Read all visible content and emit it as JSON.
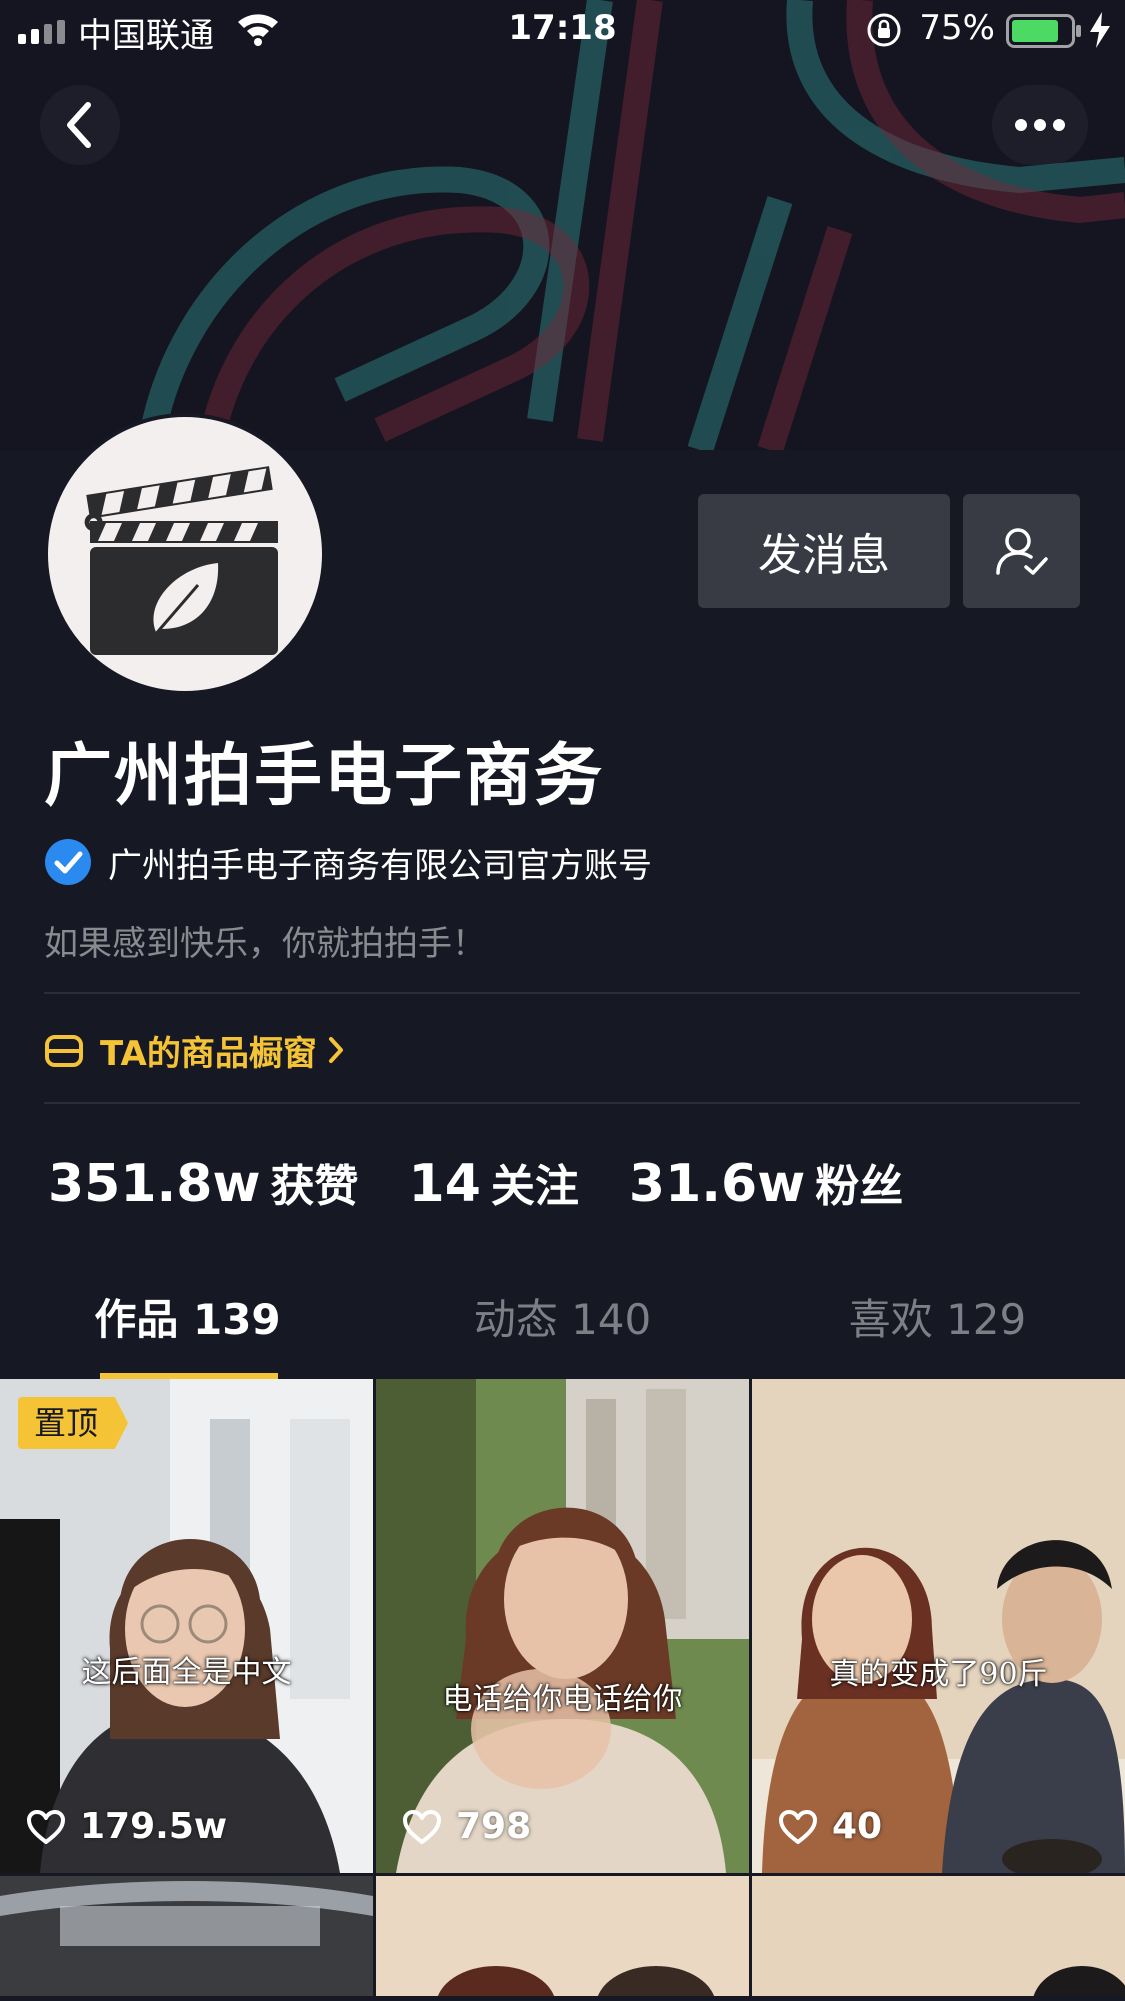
{
  "status_bar": {
    "carrier": "中国联通",
    "time": "17:18",
    "battery_percent": "75%"
  },
  "header": {
    "back_icon": "chevron-left-icon",
    "more_icon": "more-horizontal-icon"
  },
  "profile": {
    "name": "广州拍手电子商务",
    "verified_text": "广州拍手电子商务有限公司官方账号",
    "bio": "如果感到快乐，你就拍拍手！",
    "message_button": "发消息",
    "shop_label": "TA的商品橱窗",
    "stats": [
      {
        "value": "351.8w",
        "label": "获赞"
      },
      {
        "value": "14",
        "label": "关注"
      },
      {
        "value": "31.6w",
        "label": "粉丝"
      }
    ]
  },
  "tabs": [
    {
      "label": "作品 139",
      "active": true
    },
    {
      "label": "动态 140",
      "active": false
    },
    {
      "label": "喜欢 129",
      "active": false
    }
  ],
  "videos": [
    {
      "pinned_label": "置顶",
      "caption": "这后面全是中文",
      "likes": "179.5w"
    },
    {
      "caption": "电话给你电话给你",
      "likes": "798"
    },
    {
      "caption": "真的变成了90斤",
      "likes": "40"
    }
  ],
  "colors": {
    "background": "#161823",
    "accent": "#f5c336",
    "button_bg": "#393b44",
    "verified_blue": "#2b8af0"
  }
}
